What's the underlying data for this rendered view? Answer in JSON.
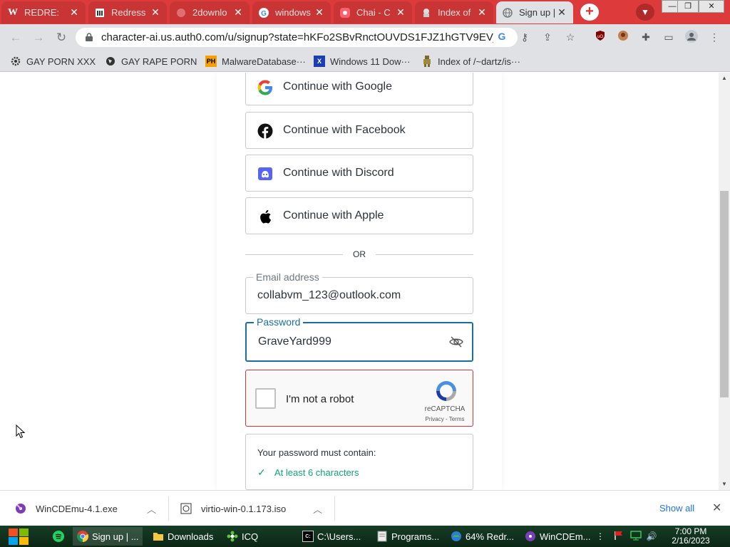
{
  "browser": {
    "tabs": [
      {
        "title": "REDRE:",
        "icon": "wikipedia-icon",
        "active": false
      },
      {
        "title": "Redress",
        "icon": "bank-icon",
        "active": false
      },
      {
        "title": "2downlo",
        "icon": "web-icon",
        "active": false
      },
      {
        "title": "windows",
        "icon": "google-icon",
        "active": false
      },
      {
        "title": "Chai - C",
        "icon": "chai-icon",
        "active": false
      },
      {
        "title": "Index of",
        "icon": "mascot-icon",
        "active": false
      },
      {
        "title": "Sign up |",
        "icon": "globe-icon",
        "active": true
      }
    ],
    "url": "character-ai.us.auth0.com/u/signup?state=hKFo2SBvRnctOUVDS1FJZ1hGTV9EVj…",
    "bookmarks": [
      {
        "label": "GAY PORN XXX",
        "icon": "gear-icon"
      },
      {
        "label": "GAY RAPE PORN",
        "icon": "globe-icon"
      },
      {
        "label": "MalwareDatabase···",
        "icon": "ph-icon",
        "icon_text": "PH"
      },
      {
        "label": "Windows 11 Dow···",
        "icon": "x-icon",
        "icon_text": "X"
      },
      {
        "label": "Index of /~dartz/is···",
        "icon": "figure-icon"
      }
    ]
  },
  "signup": {
    "social": [
      {
        "label": "Continue with Google",
        "icon": "google-icon"
      },
      {
        "label": "Continue with Facebook",
        "icon": "facebook-icon"
      },
      {
        "label": "Continue with Discord",
        "icon": "discord-icon"
      },
      {
        "label": "Continue with Apple",
        "icon": "apple-icon"
      }
    ],
    "divider": "OR",
    "email": {
      "label": "Email address",
      "value": "collabvm_123@outlook.com"
    },
    "password": {
      "label": "Password",
      "value": "GraveYard999"
    },
    "captcha": {
      "label": "I'm not a robot",
      "brand": "reCAPTCHA",
      "links": "Privacy - Terms"
    },
    "requirements": {
      "title": "Your password must contain:",
      "items": [
        "At least 6 characters"
      ]
    }
  },
  "downloads": {
    "items": [
      {
        "name": "WinCDEmu-4.1.exe"
      },
      {
        "name": "virtio-win-0.1.173.iso"
      }
    ],
    "show_all": "Show all",
    "close": "✕"
  },
  "taskbar": {
    "items": [
      {
        "label": "Sign up | ...",
        "icon": "chrome-icon",
        "active": true
      },
      {
        "label": "Downloads",
        "icon": "folder-icon"
      },
      {
        "label": "ICQ",
        "icon": "icq-icon"
      },
      {
        "label": "C:\\Users...",
        "icon": "console-icon",
        "icon_text": "C:"
      },
      {
        "label": "Programs...",
        "icon": "programs-icon"
      },
      {
        "label": "64% Redr...",
        "icon": "redress-icon"
      },
      {
        "label": "WinCDEm...",
        "icon": "wincdemu-icon"
      }
    ],
    "time": "7:00 PM",
    "date": "2/16/2023"
  },
  "colors": {
    "accent": "#10a37f",
    "tab_strip": "#dd3b3b",
    "focus_border": "#1a6fa0",
    "captcha_error": "#dd3333"
  }
}
